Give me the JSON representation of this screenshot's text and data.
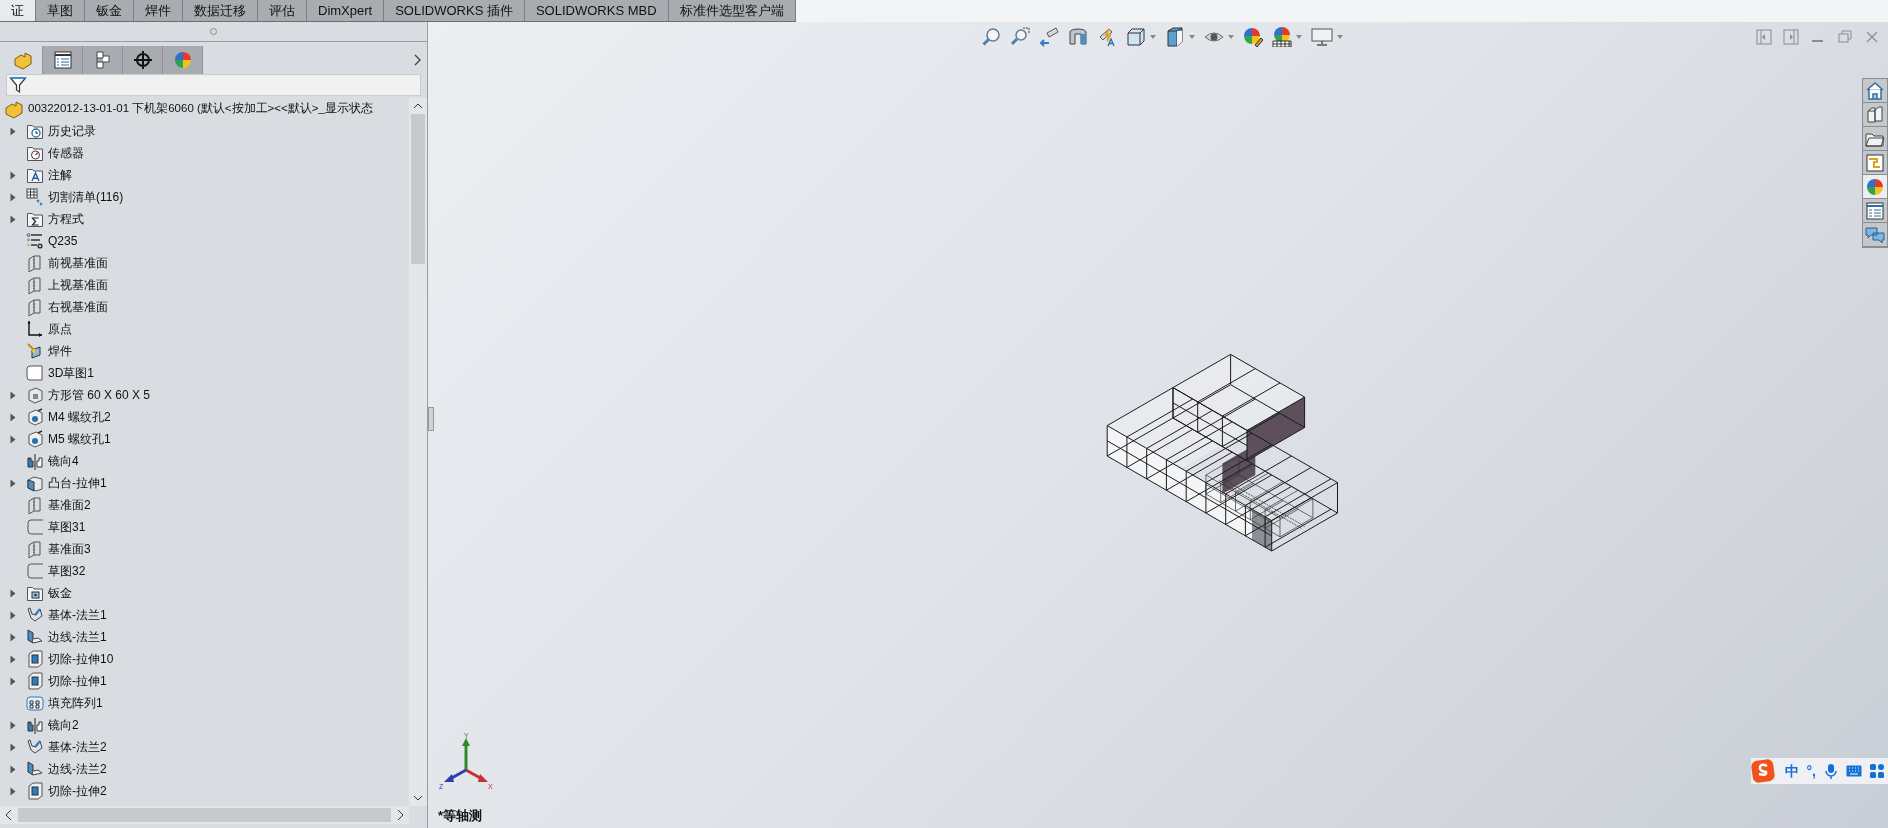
{
  "command_tabs": [
    {
      "label": "证",
      "selected": true
    },
    {
      "label": "草图",
      "selected": false
    },
    {
      "label": "钣金",
      "selected": false
    },
    {
      "label": "焊件",
      "selected": false
    },
    {
      "label": "数据迁移",
      "selected": false
    },
    {
      "label": "评估",
      "selected": false
    },
    {
      "label": "DimXpert",
      "selected": false
    },
    {
      "label": "SOLIDWORKS 插件",
      "selected": false
    },
    {
      "label": "SOLIDWORKS MBD",
      "selected": false
    },
    {
      "label": "标准件选型客户端",
      "selected": false
    }
  ],
  "feature_manager": {
    "panel_tabs": [
      {
        "kind": "feature-tree",
        "selected": true
      },
      {
        "kind": "property",
        "selected": false
      },
      {
        "kind": "configuration",
        "selected": false
      },
      {
        "kind": "dimxpert",
        "selected": false
      },
      {
        "kind": "display",
        "selected": false
      }
    ],
    "root": {
      "label": "00322012-13-01-01 下机架6060  (默认<按加工><<默认>_显示状态"
    },
    "items": [
      {
        "label": "历史记录",
        "kind": "history",
        "has_children": true
      },
      {
        "label": "传感器",
        "kind": "sensor",
        "has_children": false
      },
      {
        "label": "注解",
        "kind": "annotation",
        "has_children": true
      },
      {
        "label": "切割清单(116)",
        "kind": "cutlist",
        "has_children": true
      },
      {
        "label": "方程式",
        "kind": "equation",
        "has_children": true
      },
      {
        "label": "Q235",
        "kind": "material",
        "has_children": false
      },
      {
        "label": "前视基准面",
        "kind": "plane",
        "has_children": false
      },
      {
        "label": "上视基准面",
        "kind": "plane",
        "has_children": false
      },
      {
        "label": "右视基准面",
        "kind": "plane",
        "has_children": false
      },
      {
        "label": "原点",
        "kind": "origin",
        "has_children": false
      },
      {
        "label": "焊件",
        "kind": "weldment",
        "has_children": false
      },
      {
        "label": "3D草图1",
        "kind": "sketch3d",
        "has_children": false
      },
      {
        "label": "方形管 60 X 60 X 5",
        "kind": "profile",
        "has_children": true
      },
      {
        "label": "M4 螺纹孔2",
        "kind": "hole",
        "has_children": true
      },
      {
        "label": "M5 螺纹孔1",
        "kind": "hole",
        "has_children": true
      },
      {
        "label": "镜向4",
        "kind": "mirror",
        "has_children": false
      },
      {
        "label": "凸台-拉伸1",
        "kind": "boss",
        "has_children": true
      },
      {
        "label": "基准面2",
        "kind": "plane",
        "has_children": false
      },
      {
        "label": "草图31",
        "kind": "sketch",
        "has_children": false
      },
      {
        "label": "基准面3",
        "kind": "plane",
        "has_children": false
      },
      {
        "label": "草图32",
        "kind": "sketch",
        "has_children": false
      },
      {
        "label": "钣金",
        "kind": "sheetmetal",
        "has_children": true
      },
      {
        "label": "基体-法兰1",
        "kind": "baseflange",
        "has_children": true
      },
      {
        "label": "边线-法兰1",
        "kind": "edgeflange",
        "has_children": true
      },
      {
        "label": "切除-拉伸10",
        "kind": "cut",
        "has_children": true
      },
      {
        "label": "切除-拉伸1",
        "kind": "cut",
        "has_children": true
      },
      {
        "label": "填充阵列1",
        "kind": "pattern",
        "has_children": false
      },
      {
        "label": "镜向2",
        "kind": "mirror",
        "has_children": true
      },
      {
        "label": "基体-法兰2",
        "kind": "baseflange",
        "has_children": true
      },
      {
        "label": "边线-法兰2",
        "kind": "edgeflange",
        "has_children": true
      },
      {
        "label": "切除-拉伸2",
        "kind": "cut",
        "has_children": true
      }
    ]
  },
  "viewport": {
    "triad": {
      "x": "X",
      "y": "Y",
      "z": "Z"
    },
    "view_name": "*等轴测"
  },
  "ime_bar": {
    "mode": "中",
    "punctuation": "°,"
  }
}
